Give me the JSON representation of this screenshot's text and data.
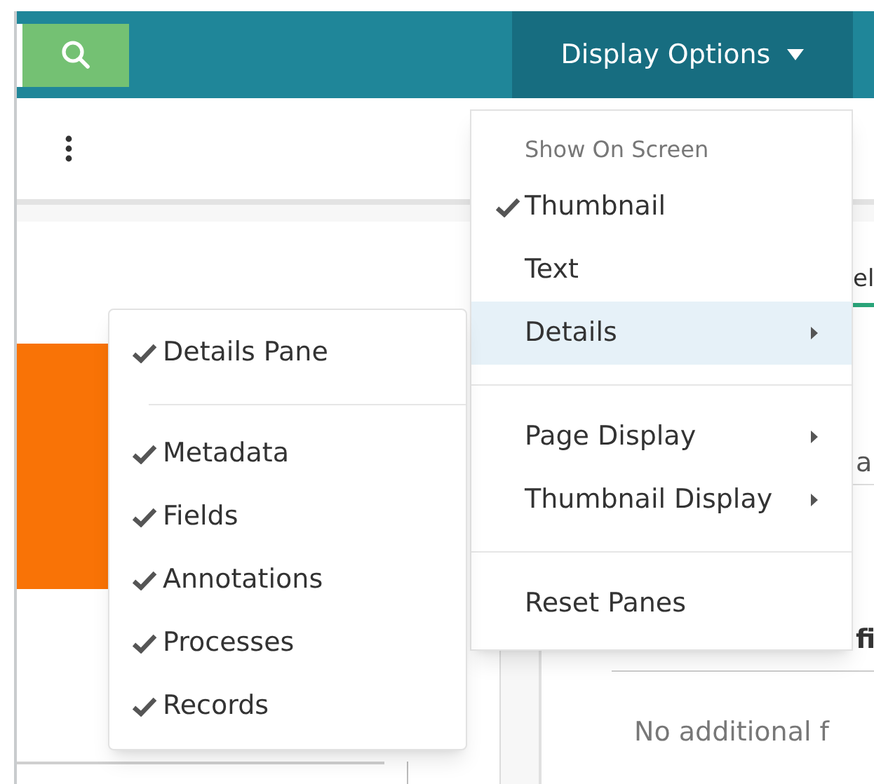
{
  "top_bar": {
    "display_options": {
      "label": "Display Options",
      "expanded": true
    }
  },
  "background": {
    "tab_fragment": "el",
    "row_fragment": "a",
    "heading_fragment": "fi",
    "empty_message": "No additional f"
  },
  "display_menu": {
    "header": "Show On Screen",
    "groups": [
      [
        {
          "label": "Thumbnail",
          "checked": true,
          "selected": false,
          "submenu": false
        },
        {
          "label": "Text",
          "checked": false,
          "selected": false,
          "submenu": false
        },
        {
          "label": "Details",
          "checked": false,
          "selected": true,
          "submenu": true
        }
      ],
      [
        {
          "label": "Page Display",
          "checked": false,
          "selected": false,
          "submenu": true
        },
        {
          "label": "Thumbnail Display",
          "checked": false,
          "selected": false,
          "submenu": true
        }
      ],
      [
        {
          "label": "Reset Panes",
          "checked": false,
          "selected": false,
          "submenu": false
        }
      ]
    ]
  },
  "details_menu": {
    "groups": [
      [
        {
          "label": "Details Pane",
          "checked": true
        }
      ],
      [
        {
          "label": "Metadata",
          "checked": true
        },
        {
          "label": "Fields",
          "checked": true
        },
        {
          "label": "Annotations",
          "checked": true
        },
        {
          "label": "Processes",
          "checked": true
        },
        {
          "label": "Records",
          "checked": true
        }
      ]
    ]
  }
}
